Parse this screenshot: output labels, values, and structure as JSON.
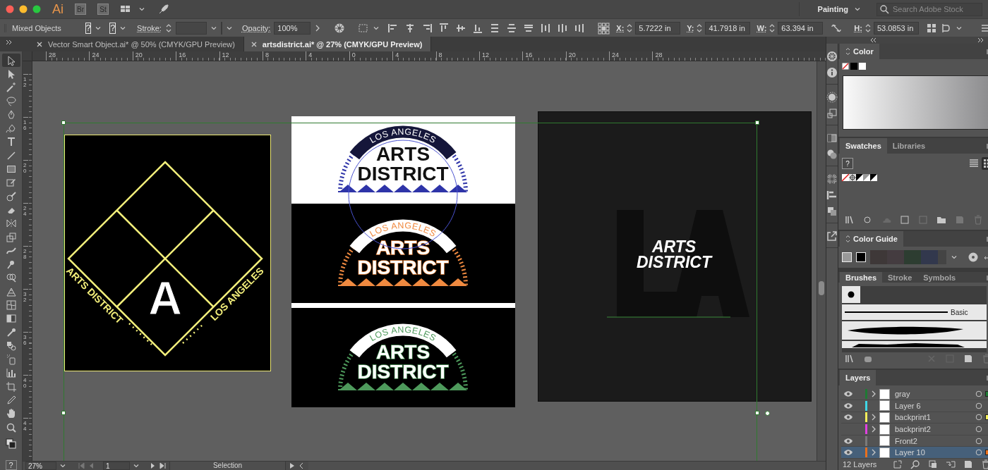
{
  "app_bar": {
    "logo": "Ai",
    "apps": [
      "Br",
      "St"
    ],
    "workspace": "Painting",
    "search": {
      "placeholder": "Search Adobe Stock"
    }
  },
  "control_bar": {
    "selection": "Mixed Objects",
    "fill": "?",
    "stroke": "?",
    "stroke_label": "Stroke:",
    "opacity_label": "Opacity:",
    "opacity": "100%",
    "transform": [
      {
        "label": "X:",
        "value": "5.7222 in"
      },
      {
        "label": "Y:",
        "value": "41.7918 in"
      },
      {
        "label": "W:",
        "value": "63.394 in"
      },
      {
        "label": "H:",
        "value": "53.0853 in"
      }
    ]
  },
  "document_tabs": [
    {
      "title": "Vector Smart Object.ai* @ 50% (CMYK/GPU Preview)",
      "selected": false
    },
    {
      "title": "artsdistrict.ai* @ 27% (CMYK/GPU Preview)",
      "selected": true
    }
  ],
  "tools": [
    {
      "kind": "selection",
      "selected": true
    },
    {
      "kind": "direct-selection",
      "selected": false
    },
    {
      "kind": "magic-wand",
      "selected": false
    },
    {
      "kind": "lasso",
      "selected": false
    },
    {
      "kind": "pen",
      "selected": false
    },
    {
      "kind": "curvature",
      "selected": false
    },
    {
      "kind": "type",
      "selected": false
    },
    {
      "kind": "line",
      "selected": false
    },
    {
      "kind": "rectangle",
      "selected": false
    },
    {
      "kind": "shaper",
      "selected": false
    },
    {
      "kind": "blob-brush",
      "selected": false
    },
    {
      "kind": "eraser",
      "selected": false
    },
    {
      "kind": "reflect",
      "selected": false
    },
    {
      "kind": "scale",
      "selected": false
    },
    {
      "kind": "warp",
      "selected": false
    },
    {
      "kind": "puppet-warp",
      "selected": false
    },
    {
      "kind": "shape-builder",
      "selected": false
    },
    {
      "kind": "perspective-grid",
      "selected": false
    },
    {
      "kind": "mesh",
      "selected": false
    },
    {
      "kind": "gradient",
      "selected": false
    },
    {
      "kind": "eyedropper",
      "selected": false
    },
    {
      "kind": "blend",
      "selected": false
    },
    {
      "kind": "symbol-sprayer",
      "selected": false
    },
    {
      "kind": "column-graph",
      "selected": false
    },
    {
      "kind": "artboard",
      "selected": false
    },
    {
      "kind": "pencil",
      "selected": false
    },
    {
      "kind": "hand",
      "selected": false
    },
    {
      "kind": "zoom",
      "selected": false
    }
  ],
  "edit_toolbar": "?",
  "rulers": {
    "horizontal": [
      "28",
      "24",
      "20",
      "16",
      "12",
      "8",
      "4",
      "0",
      "4",
      "8",
      "12",
      "16",
      "20",
      "24",
      "28"
    ],
    "vertical": [
      "12",
      "16",
      "20",
      "24",
      "28",
      "32",
      "36",
      "40",
      "44"
    ]
  },
  "artboards": [
    {
      "kind": "diamond",
      "left_text": "ARTS DISTRICT",
      "right_text": "LOS ANGELES",
      "letter": "A"
    },
    {
      "kind": "badges",
      "badges": [
        {
          "kind": "light",
          "arc_text": "LOS ANGELES",
          "line_1": "ARTS",
          "line_2": "DISTRICT",
          "color": "#2e34a8"
        },
        {
          "kind": "dark",
          "arc_text": "LOS ANGELES",
          "line_1": "ARTS",
          "line_2": "DISTRICT",
          "color": "#f08a40"
        },
        {
          "kind": "dark",
          "arc_text": "LOS ANGELES",
          "line_1": "ARTS",
          "line_2": "DISTRICT",
          "color": "#4e9a5c"
        }
      ]
    },
    {
      "kind": "monogram",
      "line_1": "ARTS",
      "line_2": "DISTRICT"
    }
  ],
  "status_bar": {
    "zoom": "27%",
    "page": "1",
    "tool": "Selection"
  },
  "panels": {
    "color": {
      "tabs": [
        {
          "label": "Color",
          "selected": true
        }
      ]
    },
    "swatches": {
      "tabs": [
        {
          "label": "Swatches",
          "selected": true
        },
        {
          "label": "Libraries",
          "selected": false
        }
      ],
      "fill_stroke": "?",
      "views": [
        {
          "kind": "list",
          "selected": false
        },
        {
          "kind": "grid",
          "selected": true
        }
      ]
    },
    "color_guide": {
      "tabs": [
        {
          "label": "Color Guide",
          "selected": true
        }
      ]
    },
    "brushes": {
      "tabs": [
        {
          "label": "Brushes",
          "selected": true
        },
        {
          "label": "Stroke",
          "selected": false
        },
        {
          "label": "Symbols",
          "selected": false
        }
      ],
      "brush_name": "Basic"
    },
    "layers": {
      "tabs": [
        {
          "label": "Layers",
          "selected": true
        }
      ],
      "rows": [
        {
          "name": "gray",
          "visible": true,
          "color": "#1f7a34",
          "expandable": true,
          "selected": false,
          "has_selection": true
        },
        {
          "name": "Layer 6",
          "visible": true,
          "color": "#3fd6e6",
          "expandable": false,
          "selected": false,
          "has_selection": false
        },
        {
          "name": "backprint1",
          "visible": true,
          "color": "#f2ee5a",
          "expandable": true,
          "selected": false,
          "has_selection": true
        },
        {
          "name": "backprint2",
          "visible": false,
          "color": "#e040e0",
          "expandable": true,
          "selected": false,
          "has_selection": false
        },
        {
          "name": "Front2",
          "visible": true,
          "color": "#7a7a7a",
          "expandable": false,
          "selected": false,
          "has_selection": false
        },
        {
          "name": "Layer 10",
          "visible": true,
          "color": "#e8701e",
          "expandable": true,
          "selected": true,
          "has_selection": true
        }
      ],
      "count": "12 Layers"
    }
  }
}
